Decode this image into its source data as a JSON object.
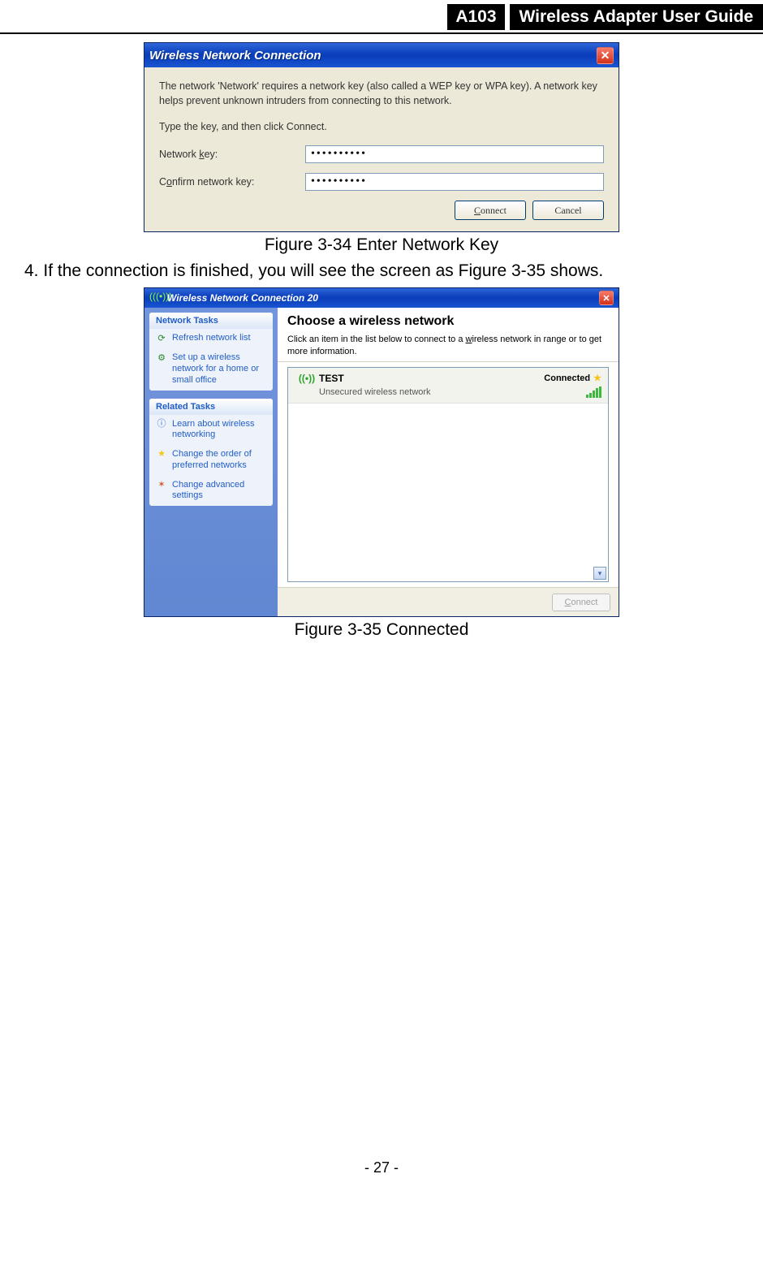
{
  "header": {
    "badge": "A103",
    "title": "Wireless Adapter User Guide"
  },
  "dialog1": {
    "window_title": "Wireless Network Connection",
    "intro_para": "The network 'Network' requires a network key (also called a WEP key or WPA key). A network key helps prevent unknown intruders from connecting to this network.",
    "prompt_line": "Type the key, and then click Connect.",
    "label_key": "Network key:",
    "label_confirm": "Confirm network key:",
    "key_value": "••••••••••",
    "confirm_value": "••••••••••",
    "connect_label": "Connect",
    "cancel_label": "Cancel"
  },
  "caption1": "Figure 3-34 Enter Network Key",
  "step4_prefix": "4.  ",
  "step4_text_a": "If the connection is finished, you will see the screen as ",
  "step4_ref": "Figure 3-35",
  "step4_text_b": " shows.",
  "dialog2": {
    "window_title": "Wireless Network Connection 20",
    "network_tasks_head": "Network Tasks",
    "task_refresh": "Refresh network list",
    "task_setup": "Set up a wireless network for a home or small office",
    "related_tasks_head": "Related Tasks",
    "task_learn": "Learn about wireless networking",
    "task_order": "Change the order of preferred networks",
    "task_advanced": "Change advanced settings",
    "main_heading": "Choose a wireless network",
    "main_intro_a": "Click an item in the list below to connect to a ",
    "main_intro_u": "w",
    "main_intro_b": "ireless network in range or to get more information.",
    "net_name": "TEST",
    "net_sub": "Unsecured wireless network",
    "net_status": "Connected",
    "connect_label": "Connect"
  },
  "caption2": "Figure 3-35 Connected",
  "page_number": "- 27 -"
}
